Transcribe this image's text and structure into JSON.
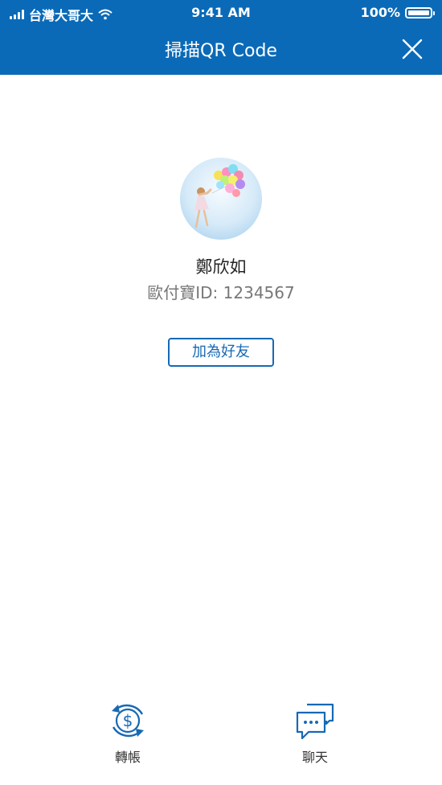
{
  "status_bar": {
    "carrier": "台灣大哥大",
    "time": "9:41 AM",
    "battery": "100%",
    "battery_level": 1.0
  },
  "header": {
    "title": "掃描QR Code",
    "close_icon": "close-icon"
  },
  "profile": {
    "name": "鄭欣如",
    "id_label": "歐付寶ID:",
    "id_value": "1234567"
  },
  "actions": {
    "add_friend": "加為好友",
    "transfer": "轉帳",
    "chat": "聊天"
  },
  "colors": {
    "brand": "#0a6ab8",
    "accent": "#1769b4",
    "secondary_text": "#777777"
  },
  "icons": {
    "signal": "signal-icon",
    "wifi": "wifi-icon",
    "battery": "battery-icon",
    "transfer": "transfer-icon",
    "chat": "chat-icon"
  }
}
